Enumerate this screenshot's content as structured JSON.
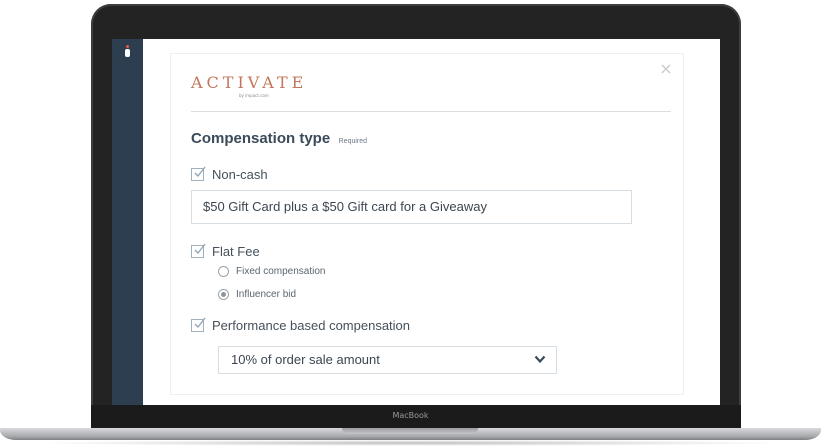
{
  "device": {
    "label": "MacBook"
  },
  "card": {
    "brand": {
      "name": "ACTIVATE",
      "sub": "by impact.com"
    },
    "close_icon": "close-icon",
    "compensation": {
      "title": "Compensation type",
      "required": "Required",
      "non_cash": {
        "label": "Non-cash",
        "checked": true,
        "value": "$50 Gift Card plus a $50 Gift card for a Giveaway"
      },
      "flat_fee": {
        "label": "Flat Fee",
        "checked": true,
        "options": [
          {
            "label": "Fixed compensation",
            "selected": false
          },
          {
            "label": "Influencer bid",
            "selected": true
          }
        ]
      },
      "performance": {
        "label": "Performance based compensation",
        "checked": true,
        "selected_option": "10% of order sale amount"
      }
    }
  }
}
